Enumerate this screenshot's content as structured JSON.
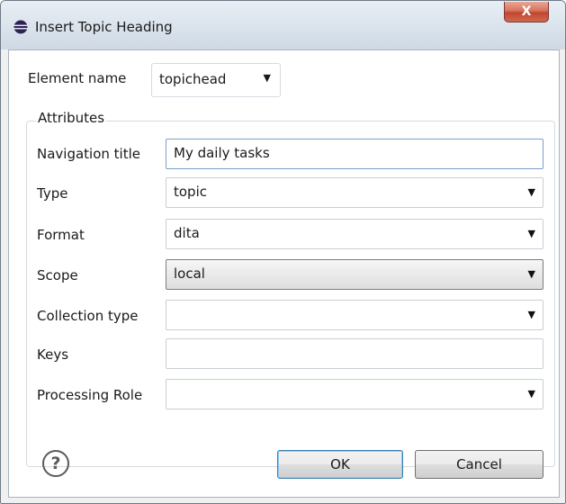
{
  "window": {
    "title": "Insert Topic Heading",
    "title_icon": "eclipse-icon",
    "close_label": "X"
  },
  "element_name": {
    "label": "Element name",
    "value": "topichead"
  },
  "attributes": {
    "group_label": "Attributes",
    "fields": [
      {
        "label": "Navigation title",
        "value": "My daily tasks",
        "kind": "text"
      },
      {
        "label": "Type",
        "value": "topic",
        "kind": "combo"
      },
      {
        "label": "Format",
        "value": "dita",
        "kind": "combo"
      },
      {
        "label": "Scope",
        "value": "local",
        "kind": "combo"
      },
      {
        "label": "Collection type",
        "value": "",
        "kind": "combo"
      },
      {
        "label": "Keys",
        "value": "",
        "kind": "text"
      },
      {
        "label": "Processing Role",
        "value": "",
        "kind": "combo"
      }
    ]
  },
  "footer": {
    "help_icon": "help-icon",
    "help_glyph": "?",
    "ok_label": "OK",
    "cancel_label": "Cancel"
  }
}
